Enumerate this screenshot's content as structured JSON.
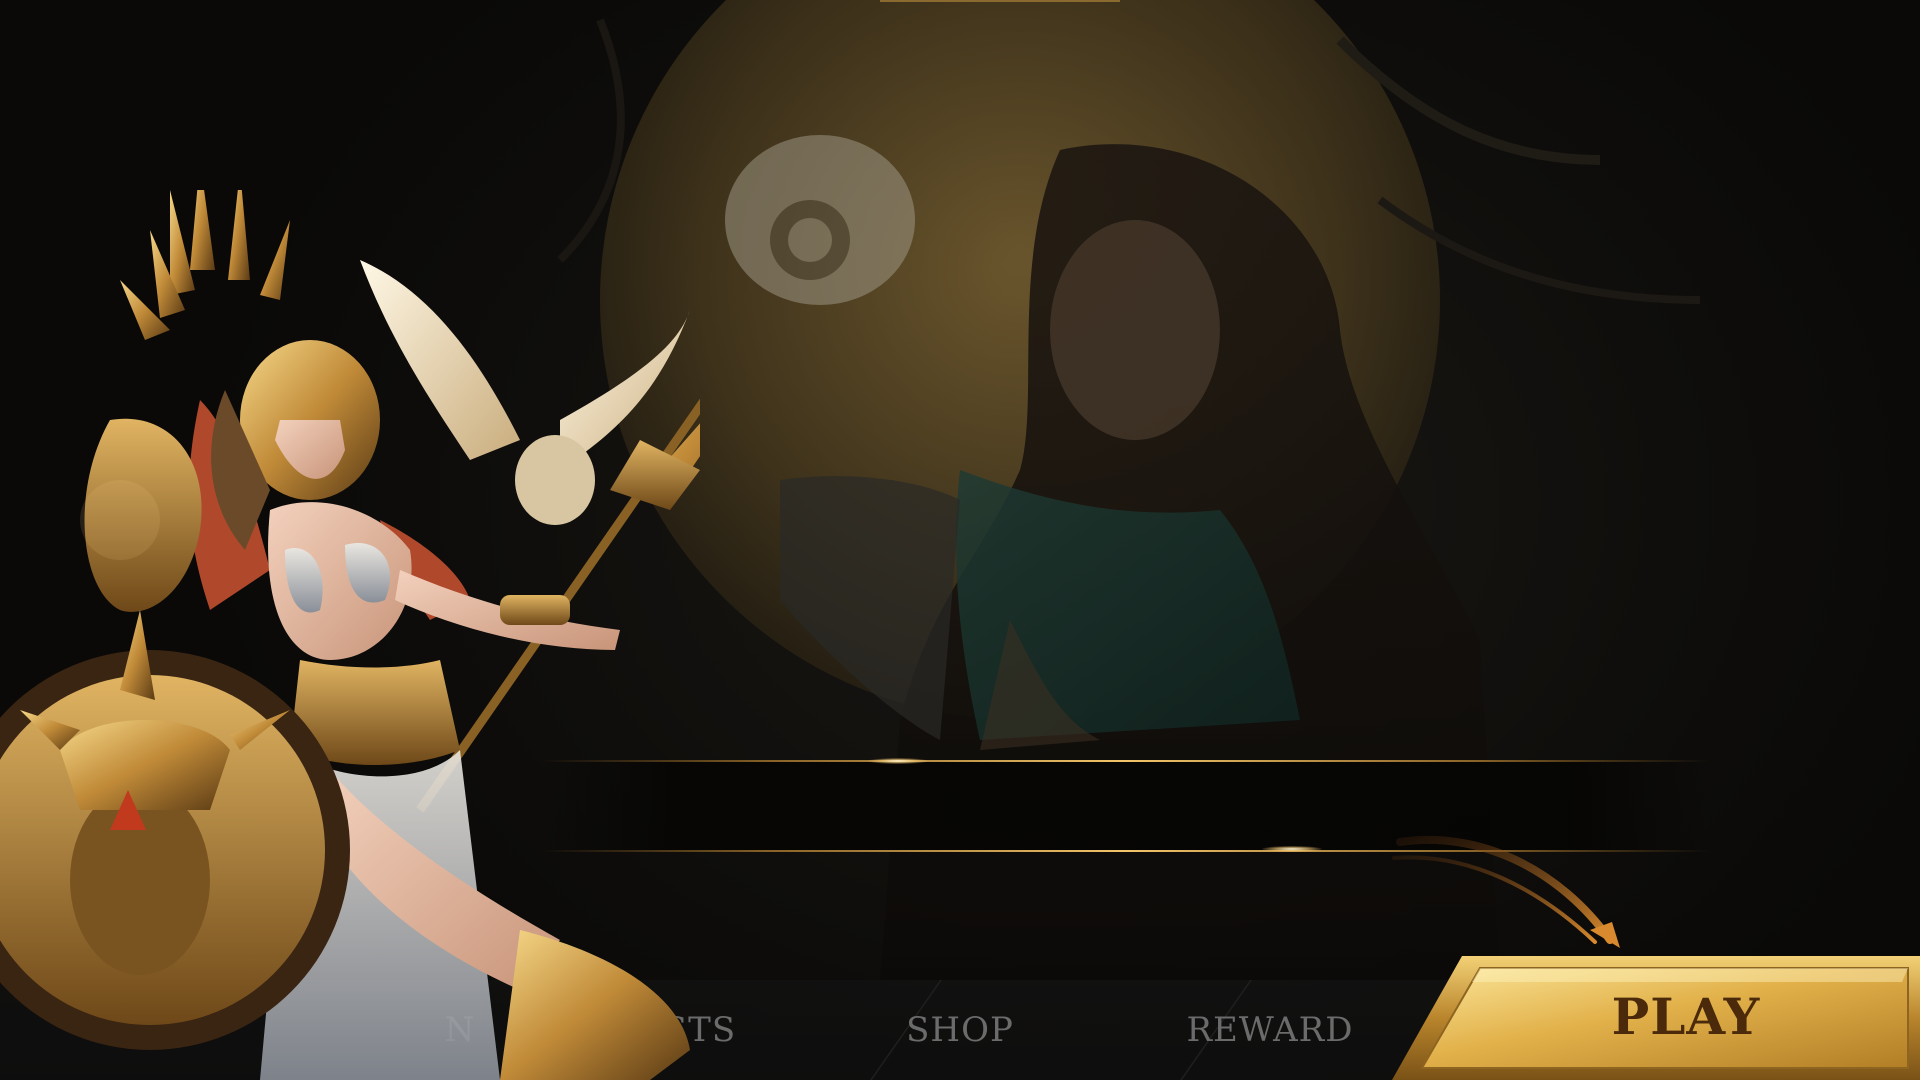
{
  "nav": {
    "items": [
      {
        "label": "N"
      },
      {
        "label": "STS"
      },
      {
        "label": "SHOP"
      },
      {
        "label": "REWARD"
      }
    ]
  },
  "play_button": {
    "label": "PLAY"
  },
  "colors": {
    "gold": "#d9a83c",
    "gold_light": "#f6d77a",
    "play_text": "#4a2a0a",
    "nav_text": "#6b6b6b"
  },
  "icons": [
    "arrow-icon",
    "hero-character",
    "background-art"
  ]
}
